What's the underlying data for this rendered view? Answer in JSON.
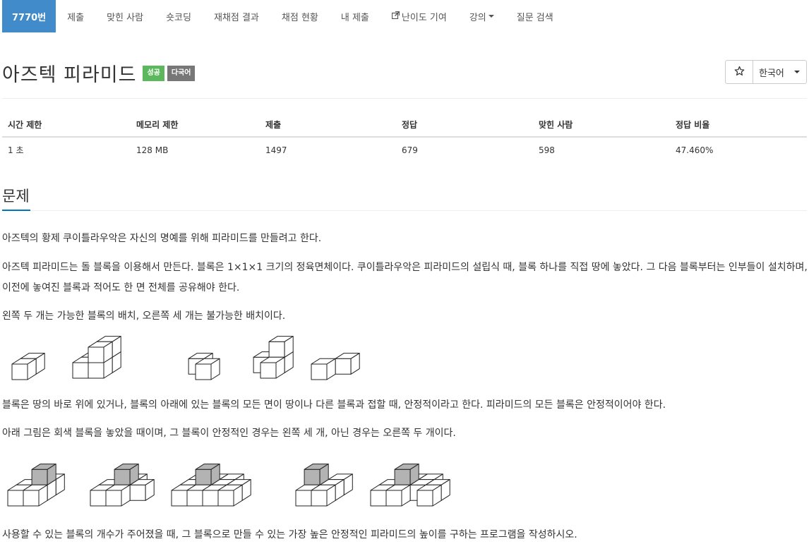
{
  "nav": {
    "items": [
      {
        "label": "7770번",
        "active": true
      },
      {
        "label": "제출"
      },
      {
        "label": "맞힌 사람"
      },
      {
        "label": "숏코딩"
      },
      {
        "label": "재채점 결과"
      },
      {
        "label": "채점 현황"
      },
      {
        "label": "내 제출"
      },
      {
        "label": "난이도 기여",
        "icon": "external-link-icon"
      },
      {
        "label": "강의",
        "icon": "caret-down-icon"
      },
      {
        "label": "질문 검색"
      }
    ]
  },
  "problem": {
    "title": "아즈텍 피라미드",
    "labels": {
      "success": "성공",
      "multilang": "다국어"
    },
    "star_icon": "star-outline-icon",
    "language": "한국어"
  },
  "info_table": {
    "headers": [
      "시간 제한",
      "메모리 제한",
      "제출",
      "정답",
      "맞힌 사람",
      "정답 비율"
    ],
    "values": [
      "1 초",
      "128 MB",
      "1497",
      "679",
      "598",
      "47.460%"
    ]
  },
  "section": {
    "headline": "문제",
    "paragraphs": [
      "아즈텍의 황제 쿠이틀라우악은 자신의 명예를 위해 피라미드를 만들려고 한다.",
      "아즈텍 피라미드는 돌 블록을 이용해서 만든다. 블록은 1×1×1 크기의 정육면체이다. 쿠이틀라우악은 피라미드의 설립식 때, 블록 하나를 직접 땅에 놓았다. 그 다음 블록부터는 인부들이 설치하며, 이전에 놓여진 블록과 적어도 한 면 전체를 공유해야 한다.",
      "왼쪽 두 개는 가능한 블록의 배치, 오른쪽 세 개는 불가능한 배치이다.",
      "블록은 땅의 바로 위에 있거나, 블록의 아래에 있는 블록의 모든 면이 땅이나 다른 블록과 접할 때, 안정적이라고 한다. 피라미드의 모든 블록은 안정적이어야 한다.",
      "아래 그림은 회색 블록을 놓았을 때이며, 그 블록이 안정적인 경우는 왼쪽 세 개, 아닌 경우는 오른쪽 두 개이다.",
      "사용할 수 있는 블록의 개수가 주어졌을 때, 그 블록으로 만들 수 있는 가장 높은 안정적인 피라미드의 높이를 구하는 프로그램을 작성하시오."
    ]
  },
  "colors": {
    "active_tab": "#428bca",
    "label_success": "#5cb85c",
    "label_multilang": "#777777",
    "headline_underline": "#0076c0",
    "gray_block": "#b3b3b3"
  }
}
